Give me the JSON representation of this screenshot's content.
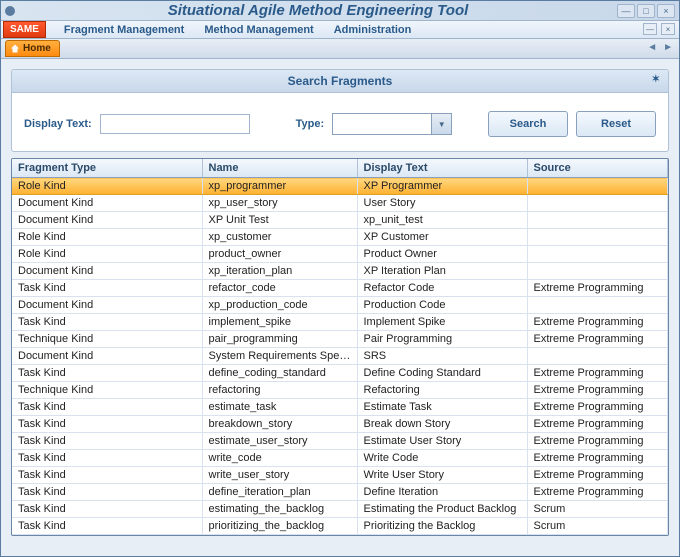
{
  "window": {
    "title": "Situational Agile Method Engineering Tool"
  },
  "brand": "SAME",
  "menus": [
    "Fragment Management",
    "Method Management",
    "Administration"
  ],
  "home_tab": "Home",
  "search_panel": {
    "title": "Search Fragments",
    "display_text_label": "Display Text:",
    "display_text_value": "",
    "type_label": "Type:",
    "type_value": "",
    "search_button": "Search",
    "reset_button": "Reset"
  },
  "table": {
    "columns": [
      "Fragment Type",
      "Name",
      "Display Text",
      "Source"
    ],
    "rows": [
      {
        "fragment_type": "Role Kind",
        "name": "xp_programmer",
        "display_text": "XP Programmer",
        "source": ""
      },
      {
        "fragment_type": "Document Kind",
        "name": "xp_user_story",
        "display_text": "User Story",
        "source": ""
      },
      {
        "fragment_type": "Document Kind",
        "name": "XP Unit Test",
        "display_text": "xp_unit_test",
        "source": ""
      },
      {
        "fragment_type": "Role Kind",
        "name": "xp_customer",
        "display_text": "XP Customer",
        "source": ""
      },
      {
        "fragment_type": "Role Kind",
        "name": "product_owner",
        "display_text": "Product Owner",
        "source": ""
      },
      {
        "fragment_type": "Document Kind",
        "name": "xp_iteration_plan",
        "display_text": "XP Iteration Plan",
        "source": ""
      },
      {
        "fragment_type": "Task Kind",
        "name": "refactor_code",
        "display_text": "Refactor Code",
        "source": "Extreme Programming"
      },
      {
        "fragment_type": "Document Kind",
        "name": "xp_production_code",
        "display_text": "Production Code",
        "source": ""
      },
      {
        "fragment_type": "Task Kind",
        "name": "implement_spike",
        "display_text": "Implement Spike",
        "source": "Extreme Programming"
      },
      {
        "fragment_type": "Technique Kind",
        "name": "pair_programming",
        "display_text": "Pair Programming",
        "source": "Extreme Programming"
      },
      {
        "fragment_type": "Document Kind",
        "name": "System Requirements Specification",
        "display_text": "SRS",
        "source": ""
      },
      {
        "fragment_type": "Task Kind",
        "name": "define_coding_standard",
        "display_text": "Define Coding Standard",
        "source": "Extreme Programming"
      },
      {
        "fragment_type": "Technique Kind",
        "name": "refactoring",
        "display_text": "Refactoring",
        "source": "Extreme Programming"
      },
      {
        "fragment_type": "Task Kind",
        "name": "estimate_task",
        "display_text": "Estimate Task",
        "source": "Extreme Programming"
      },
      {
        "fragment_type": "Task Kind",
        "name": "breakdown_story",
        "display_text": "Break down Story",
        "source": "Extreme Programming"
      },
      {
        "fragment_type": "Task Kind",
        "name": "estimate_user_story",
        "display_text": "Estimate User Story",
        "source": "Extreme Programming"
      },
      {
        "fragment_type": "Task Kind",
        "name": "write_code",
        "display_text": "Write Code",
        "source": "Extreme Programming"
      },
      {
        "fragment_type": "Task Kind",
        "name": "write_user_story",
        "display_text": "Write User Story",
        "source": "Extreme Programming"
      },
      {
        "fragment_type": "Task Kind",
        "name": "define_iteration_plan",
        "display_text": "Define Iteration",
        "source": "Extreme Programming"
      },
      {
        "fragment_type": "Task Kind",
        "name": "estimating_the_backlog",
        "display_text": "Estimating the Product Backlog",
        "source": "Scrum"
      },
      {
        "fragment_type": "Task Kind",
        "name": "prioritizing_the_backlog",
        "display_text": "Prioritizing the Backlog",
        "source": "Scrum"
      }
    ],
    "selected_index": 0
  }
}
